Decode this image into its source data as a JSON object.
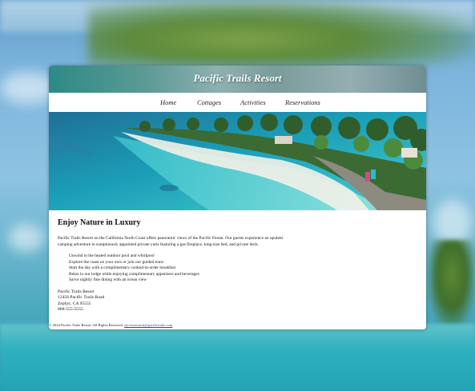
{
  "site": {
    "title": "Pacific Trails Resort"
  },
  "nav": {
    "items": [
      {
        "label": "Home"
      },
      {
        "label": "Cottages"
      },
      {
        "label": "Activities"
      },
      {
        "label": "Reservations"
      }
    ]
  },
  "main": {
    "heading": "Enjoy Nature in Luxury",
    "intro": "Pacific Trails Resort on the California North Coast offers panoramic views of the Pacific Ocean. Our guests experience an opulent camping adventure in sumptuously appointed private yurts featuring a gas fireplace, king-size bed, and private deck.",
    "features": [
      "Unwind in the heated outdoor pool and whirlpool",
      "Explore the coast on your own or join our guided tours",
      "Start the day with a complimentary cooked-to-order breakfast",
      "Relax in our lodge while enjoying complimentary appetizers and beverages",
      "Savor nightly fine dining with an ocean view"
    ],
    "address": {
      "name": "Pacific Trails Resort",
      "street": "12456 Pacific Trails Road",
      "city": "Zephyr, CA 95555",
      "phone": "888-555-5555"
    }
  },
  "footer": {
    "copyright": "© 2024 Pacific Trails Resort. All Rights Reserved.",
    "email": "slyvesteruwai@pacifictrails.com"
  },
  "colors": {
    "header_teal": "#2d8a86",
    "link_blue": "#3b3bbd"
  }
}
